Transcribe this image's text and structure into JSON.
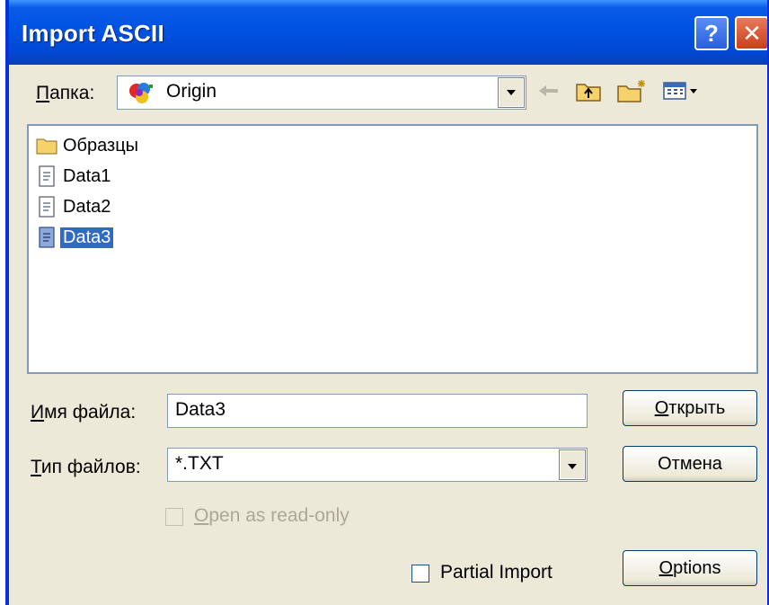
{
  "window": {
    "title": "Import ASCII",
    "help_label": "?",
    "close_label": "✕"
  },
  "look_in": {
    "label": "Папка:",
    "value": "Origin",
    "icon": "origin-app-icon"
  },
  "toolbar": {
    "back_icon": "back-arrow-icon",
    "up_icon": "up-folder-icon",
    "new_folder_icon": "new-folder-icon",
    "view_icon": "view-menu-icon"
  },
  "files": [
    {
      "name": "Образцы",
      "icon": "folder-icon",
      "selected": false
    },
    {
      "name": "Data1",
      "icon": "document-icon",
      "selected": false
    },
    {
      "name": "Data2",
      "icon": "document-icon",
      "selected": false
    },
    {
      "name": "Data3",
      "icon": "document-icon",
      "selected": true
    }
  ],
  "filename": {
    "label": "Имя файла:",
    "value": "Data3"
  },
  "filetype": {
    "label": "Тип файлов:",
    "value": "*.TXT"
  },
  "readonly": {
    "label": "Open as read-only",
    "checked": false,
    "enabled": false
  },
  "partial": {
    "label": "Partial Import",
    "checked": false
  },
  "buttons": {
    "open": "Открыть",
    "cancel": "Отмена",
    "options": "Options"
  },
  "colors": {
    "titlebar": "#0054e3",
    "dialog_bg": "#ece9d8",
    "selection": "#316ac5"
  }
}
